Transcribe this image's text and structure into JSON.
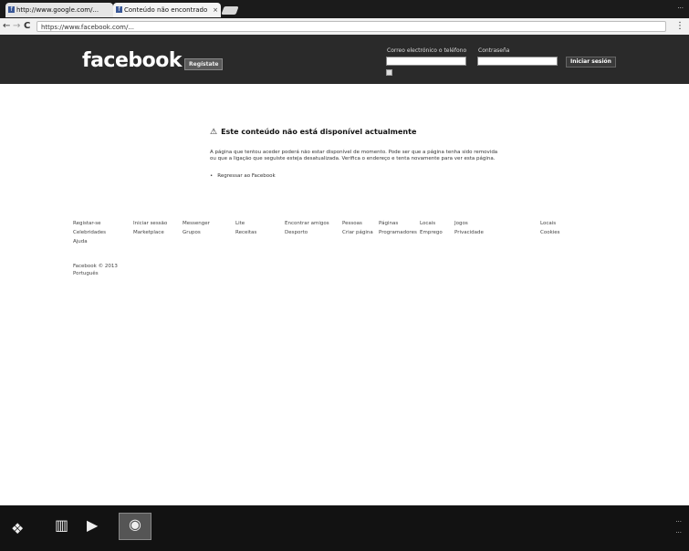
{
  "browser": {
    "tabs": [
      {
        "title": "http://www.google.com/..."
      },
      {
        "title": "Conteúdo não encontrado"
      }
    ],
    "url": "https://www.facebook.com/...",
    "user_label": "..."
  },
  "header": {
    "logo": "facebook",
    "signup_label": "Regístate",
    "email_label": "Correo electrónico o teléfono",
    "password_label": "Contraseña",
    "login_label": "Iniciar sesión"
  },
  "content": {
    "title": "Este conteúdo não está disponível actualmente",
    "body": "A página que tentou aceder poderá não estar disponível de momento. Pode ser que a página tenha sido removida ou que a ligação que seguiste esteja desatualizada. Verifica o endereço e tenta novamente para ver esta página.",
    "back_link": "Regressar ao Facebook"
  },
  "footer": {
    "links": [
      [
        "Registar-se",
        "Iniciar sessão",
        "Messenger",
        "Lite",
        "Encontrar amigos",
        "Pessoas",
        "Páginas",
        "Locais",
        "Jogos",
        "Locais"
      ],
      [
        "Celebridades",
        "Marketplace",
        "Grupos",
        "Receitas",
        "Desporto",
        "Criar página",
        "Programadores",
        "Emprego",
        "Privacidade",
        "Cookies"
      ],
      [
        "Ajuda"
      ]
    ],
    "copyright": "Facebook © 2013",
    "language": "Português"
  },
  "taskbar": {
    "tray_top": "...",
    "tray_bottom": "..."
  }
}
